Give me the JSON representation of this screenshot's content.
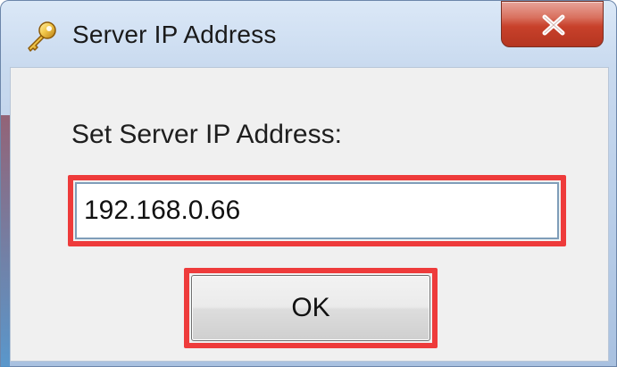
{
  "window": {
    "title": "Server IP Address",
    "title_icon": "key-icon",
    "close_icon": "close-icon"
  },
  "dialog": {
    "prompt_label": "Set Server IP Address:",
    "ip_value": "192.168.0.66",
    "ok_label": "OK"
  },
  "colors": {
    "highlight": "#ee3b3b",
    "close_button": "#c8412b",
    "client_bg": "#f0f0f0"
  }
}
